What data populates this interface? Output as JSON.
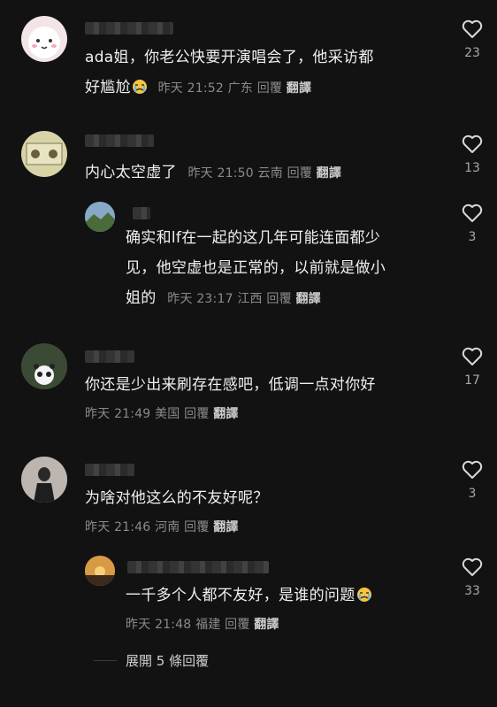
{
  "comments": [
    {
      "text_line1": "ada姐，你老公快要开演唱会了，他采访都",
      "text_line2": "好尴尬",
      "date": "昨天",
      "time": "21:52",
      "location": "广东",
      "reply": "回覆",
      "translate": "翻譯",
      "likes": "23"
    },
    {
      "text_line1": "内心太空虚了",
      "date": "昨天",
      "time": "21:50",
      "location": "云南",
      "reply": "回覆",
      "translate": "翻譯",
      "likes": "13"
    },
    {
      "text_line1": "确实和lf在一起的这几年可能连面都少",
      "text_line2": "见，他空虚也是正常的，以前就是做小",
      "text_line3": "姐的",
      "date": "昨天",
      "time": "23:17",
      "location": "江西",
      "reply": "回覆",
      "translate": "翻譯",
      "likes": "3"
    },
    {
      "text_line1": "你还是少出来刷存在感吧，低调一点对你好",
      "date": "昨天",
      "time": "21:49",
      "location": "美国",
      "reply": "回覆",
      "translate": "翻譯",
      "likes": "17"
    },
    {
      "text_line1": "为啥对他这么的不友好呢？",
      "date": "昨天",
      "time": "21:46",
      "location": "河南",
      "reply": "回覆",
      "translate": "翻譯",
      "likes": "3"
    },
    {
      "text_line1": "一千多个人都不友好，是谁的问题",
      "date": "昨天",
      "time": "21:48",
      "location": "福建",
      "reply": "回覆",
      "translate": "翻譯",
      "likes": "33"
    }
  ],
  "expand": {
    "label": "展開 5 條回覆"
  },
  "colors": {
    "background": "#121212",
    "meta_gray": "#8a8a8a",
    "text": "#f0f0f0"
  }
}
